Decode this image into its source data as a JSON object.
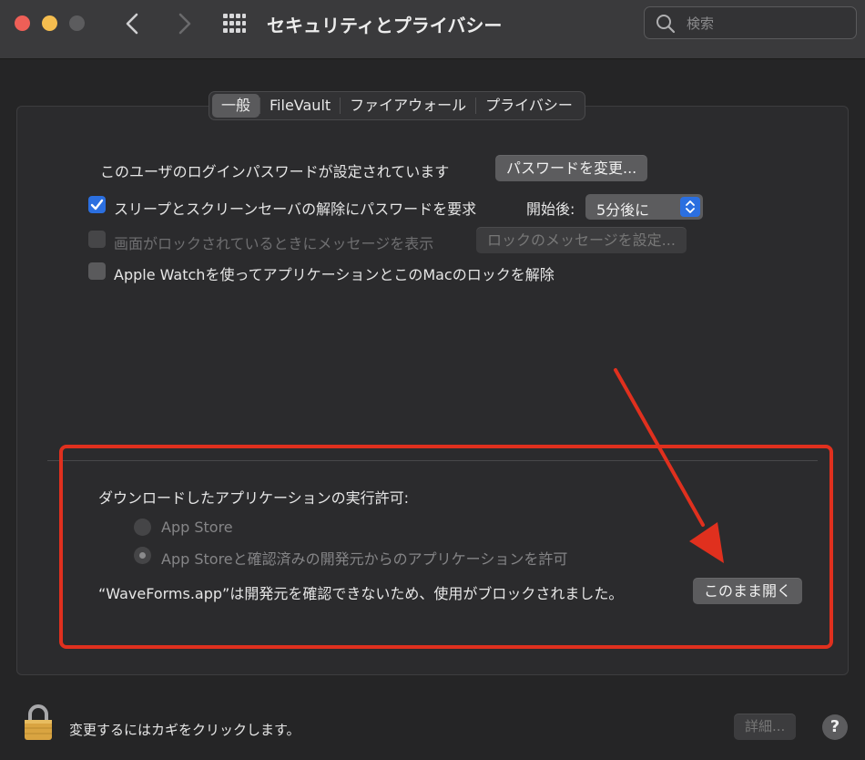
{
  "window": {
    "title": "セキュリティとプライバシー",
    "search_placeholder": "検索"
  },
  "tabs": [
    {
      "label": "一般",
      "active": true
    },
    {
      "label": "FileVault",
      "active": false
    },
    {
      "label": "ファイアウォール",
      "active": false
    },
    {
      "label": "プライバシー",
      "active": false
    }
  ],
  "general": {
    "password_text": "このユーザのログインパスワードが設定されています",
    "change_password_button": "パスワードを変更...",
    "require_password_label": "スリープとスクリーンセーバの解除にパスワードを要求",
    "require_password_checked": true,
    "after_label": "開始後:",
    "after_value": "5分後に",
    "lock_message_label": "画面がロックされているときにメッセージを表示",
    "lock_message_checked": false,
    "lock_message_button": "ロックのメッセージを設定...",
    "apple_watch_label": "Apple Watchを使ってアプリケーションとこのMacのロックを解除",
    "apple_watch_checked": false
  },
  "downloads": {
    "heading": "ダウンロードしたアプリケーションの実行許可:",
    "options": [
      {
        "label": "App Store",
        "selected": false
      },
      {
        "label": "App Storeと確認済みの開発元からのアプリケーションを許可",
        "selected": true
      }
    ],
    "blocked_message": "“WaveForms.app”は開発元を確認できないため、使用がブロックされました。",
    "open_anyway_button": "このまま開く"
  },
  "footer": {
    "lock_text": "変更するにはカギをクリックします。",
    "advanced_button": "詳細...",
    "help_button": "?"
  },
  "colors": {
    "accent": "#2b6fe0",
    "annotation": "#e0301e"
  }
}
